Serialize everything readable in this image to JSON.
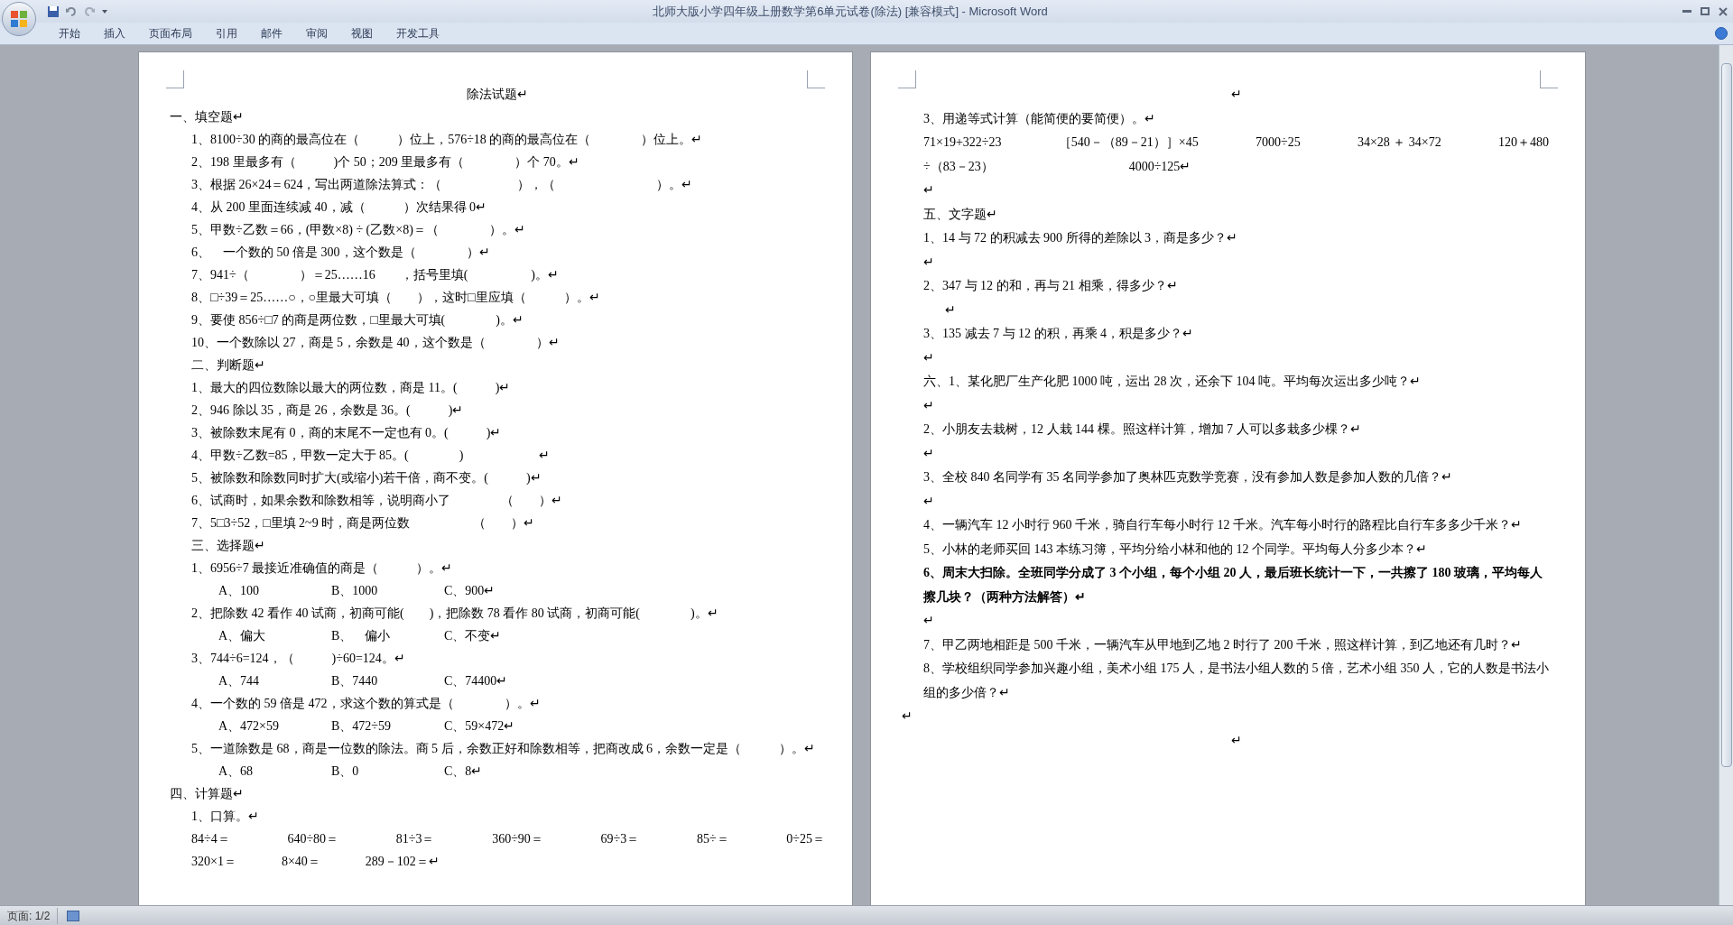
{
  "window": {
    "title": "北师大版小学四年级上册数学第6单元试卷(除法) [兼容模式] - Microsoft Word"
  },
  "ribbon_tabs": [
    {
      "label": "开始"
    },
    {
      "label": "插入"
    },
    {
      "label": "页面布局"
    },
    {
      "label": "引用"
    },
    {
      "label": "邮件"
    },
    {
      "label": "审阅"
    },
    {
      "label": "视图"
    },
    {
      "label": "开发工具"
    }
  ],
  "pages": [
    {
      "lines": [
        {
          "kind": "title",
          "text": "除法试题↵"
        },
        {
          "kind": "heading",
          "text": "一、填空题↵"
        },
        {
          "kind": "item",
          "text": "1、8100÷30 的商的最高位在（　　　）位上，576÷18 的商的最高位在（　　　　）位上。↵"
        },
        {
          "kind": "item",
          "text": "2、198 里最多有（　　　)个 50；209 里最多有（　　　　）个 70。↵"
        },
        {
          "kind": "item",
          "text": "3、根据 26×24＝624，写出两道除法算式：（　　　　　　），（　　　　　　　　）。↵"
        },
        {
          "kind": "item",
          "text": "4、从 200 里面连续减 40，减（　　　）次结果得 0↵"
        },
        {
          "kind": "item",
          "text": "5、甲数÷乙数＝66，(甲数×8) ÷ (乙数×8)＝（　　　　）。↵"
        },
        {
          "kind": "item",
          "text": "6、　一个数的 50 倍是 300，这个数是（　　　　）↵"
        },
        {
          "kind": "item",
          "text": "7、941÷（　　　　）＝25……16　　，括号里填(　　　　　)。↵"
        },
        {
          "kind": "item",
          "text": "8、□÷39＝25……○，○里最大可填（　　），这时□里应填（　　　）。↵"
        },
        {
          "kind": "item",
          "text": "9、要使 856÷□7 的商是两位数，□里最大可填(　　　　)。↵"
        },
        {
          "kind": "item",
          "text": "10、一个数除以 27，商是 5，余数是 40，这个数是（　　　　）↵"
        },
        {
          "kind": "item",
          "text": "二、判断题↵"
        },
        {
          "kind": "item",
          "text": "1、最大的四位数除以最大的两位数，商是 11。(　　　)↵"
        },
        {
          "kind": "item",
          "text": "2、946 除以 35，商是 26，余数是 36。(　　　)↵"
        },
        {
          "kind": "item",
          "text": "3、被除数末尾有 0，商的末尾不一定也有 0。(　　　)↵"
        },
        {
          "kind": "item",
          "text": "4、甲数÷乙数=85，甲数一定大于 85。(　　　　)　　　　　　↵"
        },
        {
          "kind": "item",
          "text": "5、被除数和除数同时扩大(或缩小)若干倍，商不变。(　　　)↵"
        },
        {
          "kind": "item",
          "text": "6、试商时，如果余数和除数相等，说明商小了　　　　（　　）↵"
        },
        {
          "kind": "item",
          "text": "7、5□3÷52，□里填 2~9 时，商是两位数　　　　　（　　）↵"
        },
        {
          "kind": "item",
          "text": "三、选择题↵"
        },
        {
          "kind": "item",
          "text": "1、6956÷7 最接近准确值的商是（　　　）。↵"
        },
        {
          "kind": "options",
          "cells": [
            "A、100",
            "B、1000",
            "C、900↵"
          ]
        },
        {
          "kind": "item",
          "text": "2、把除数 42 看作 40 试商，初商可能(　　)，把除数 78 看作 80 试商，初商可能(　　　　)。↵"
        },
        {
          "kind": "options",
          "cells": [
            "A、偏大",
            "B、　偏小",
            "C、不变↵"
          ]
        },
        {
          "kind": "item",
          "text": "3、744÷6=124，（　　　)÷60=124。↵"
        },
        {
          "kind": "options",
          "cells": [
            "A、744",
            "B、7440",
            "C、74400↵"
          ]
        },
        {
          "kind": "item",
          "text": "4、一个数的 59 倍是 472，求这个数的算式是（　　　　）。↵"
        },
        {
          "kind": "options",
          "cells": [
            "A、472×59",
            "B、472÷59",
            "C、59×472↵"
          ]
        },
        {
          "kind": "item",
          "text": "5、一道除数是 68，商是一位数的除法。商 5 后，余数正好和除数相等，把商改成 6，余数一定是（　　　）。↵"
        },
        {
          "kind": "options",
          "cells": [
            "A、68",
            "B、0",
            "C、8↵"
          ]
        },
        {
          "kind": "heading",
          "text": "四、计算题↵"
        },
        {
          "kind": "item",
          "text": "1、口算。↵"
        },
        {
          "kind": "row",
          "cells": [
            "84÷4＝",
            "640÷80＝",
            "81÷3＝",
            "360÷90＝",
            "69÷3＝",
            "85÷＝",
            "0÷25＝"
          ]
        },
        {
          "kind": "spaced-row",
          "cells": [
            "320×1＝",
            "8×40＝",
            "289－102＝↵"
          ]
        }
      ]
    },
    {
      "lines": [
        {
          "kind": "title",
          "text": "↵"
        },
        {
          "kind": "heading",
          "text": "3、用递等式计算（能简便的要简便）。↵"
        },
        {
          "kind": "flush-row",
          "cells": [
            "71×19+322÷23",
            "［540－（89－21）］×45",
            "7000÷25",
            "34×28 ＋ 34×72",
            "120＋480"
          ]
        },
        {
          "kind": "flush-spaced-row",
          "cells": [
            "÷（83－23）",
            "4000÷125↵"
          ]
        },
        {
          "kind": "heading",
          "text": "↵"
        },
        {
          "kind": "heading",
          "text": "五、文字题↵"
        },
        {
          "kind": "heading",
          "text": "1、14 与 72 的积减去 900 所得的差除以 3，商是多少？↵"
        },
        {
          "kind": "heading",
          "text": "↵"
        },
        {
          "kind": "heading",
          "text": "2、347 与 12 的和，再与 21 相乘，得多少？↵"
        },
        {
          "kind": "item",
          "text": "↵"
        },
        {
          "kind": "heading",
          "text": "3、135 减去 7 与 12 的积，再乘 4，积是多少？↵"
        },
        {
          "kind": "heading",
          "text": "↵"
        },
        {
          "kind": "heading",
          "text": "六、1、某化肥厂生产化肥 1000 吨，运出 28 次，还余下 104 吨。平均每次运出多少吨？↵"
        },
        {
          "kind": "heading",
          "text": "↵"
        },
        {
          "kind": "heading",
          "text": "2、小朋友去栽树，12 人栽 144 棵。照这样计算，增加 7 人可以多栽多少棵？↵"
        },
        {
          "kind": "heading",
          "text": "↵"
        },
        {
          "kind": "heading",
          "text": "3、全校 840 名同学有 35 名同学参加了奥林匹克数学竞赛，没有参加人数是参加人数的几倍？↵"
        },
        {
          "kind": "heading",
          "text": "↵"
        },
        {
          "kind": "heading",
          "text": "4、一辆汽车 12 小时行 960 千米，骑自行车每小时行 12 千米。汽车每小时行的路程比自行车多多少千米？↵"
        },
        {
          "kind": "heading",
          "text": "5、小林的老师买回 143 本练习簿，平均分给小林和他的 12 个同学。平均每人分多少本？↵"
        },
        {
          "kind": "bold",
          "text": "6、周末大扫除。全班同学分成了 3 个小组，每个小组 20 人，最后班长统计一下，一共擦了 180 玻璃，平均每人擦几块？（两种方法解答）↵"
        },
        {
          "kind": "heading",
          "text": "↵"
        },
        {
          "kind": "heading",
          "text": "7、甲乙两地相距是 500 千米，一辆汽车从甲地到乙地 2 时行了 200 千米，照这样计算，到乙地还有几时？↵"
        },
        {
          "kind": "heading",
          "text": "8、学校组织同学参加兴趣小组，美术小组 175 人，是书法小组人数的 5 倍，艺术小组 350 人，它的人数是书法小组的多少倍？↵"
        },
        {
          "kind": "outdent",
          "text": "↵"
        },
        {
          "kind": "title",
          "text": "↵"
        }
      ]
    }
  ],
  "status_bar": {
    "page": "页面: 1/2"
  }
}
